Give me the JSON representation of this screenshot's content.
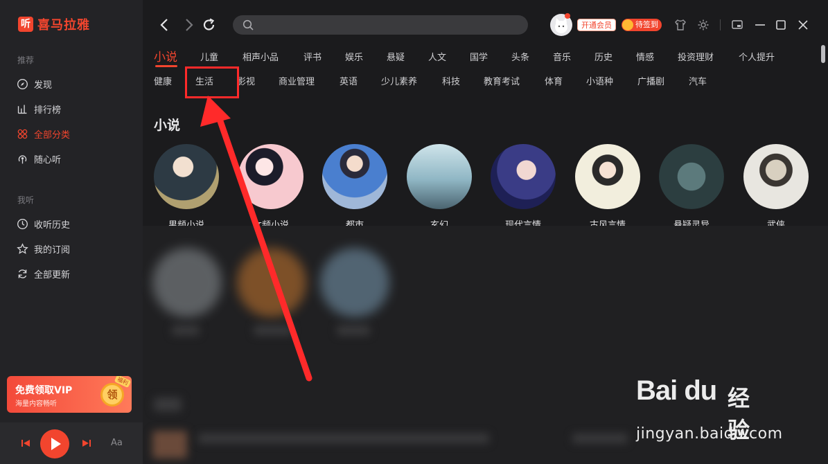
{
  "app": {
    "logo_badge": "听",
    "logo_text": "喜马拉雅"
  },
  "sidebar": {
    "section_recommend": "推荐",
    "items": [
      {
        "label": "发现",
        "icon": "compass-icon"
      },
      {
        "label": "排行榜",
        "icon": "chart-icon"
      },
      {
        "label": "全部分类",
        "icon": "grid-icon",
        "active": true
      },
      {
        "label": "随心听",
        "icon": "broadcast-icon"
      }
    ],
    "section_mine": "我听",
    "mine_items": [
      {
        "label": "收听历史",
        "icon": "clock-icon"
      },
      {
        "label": "我的订阅",
        "icon": "star-icon"
      },
      {
        "label": "全部更新",
        "icon": "refresh-icon"
      }
    ],
    "vip": {
      "title": "免费领取VIP",
      "subtitle": "海量内容畅听",
      "coin": "领",
      "tag": "福利"
    },
    "player": {
      "font_label": "Aa"
    }
  },
  "header": {
    "search_placeholder": "",
    "member_label": "开通会员",
    "checkin_label": "待签到"
  },
  "categories_row1": [
    "小说",
    "儿童",
    "相声小品",
    "评书",
    "娱乐",
    "悬疑",
    "人文",
    "国学",
    "头条",
    "音乐",
    "历史",
    "情感",
    "投资理财",
    "个人提升"
  ],
  "categories_row2": [
    "健康",
    "生活",
    "影视",
    "商业管理",
    "英语",
    "少儿素养",
    "科技",
    "教育考试",
    "体育",
    "小语种",
    "广播剧",
    "汽车"
  ],
  "section": {
    "title": "小说",
    "books": [
      "男频小说",
      "女频小说",
      "都市",
      "玄幻",
      "现代言情",
      "古风言情",
      "悬疑灵异",
      "武侠"
    ]
  },
  "watermark": {
    "brand": "Bai du",
    "brand_cn": "经验",
    "url": "jingyan.baidu.com"
  },
  "colors": {
    "accent": "#f2452e",
    "bg": "#1b1b1d",
    "sidebar": "#232326"
  }
}
